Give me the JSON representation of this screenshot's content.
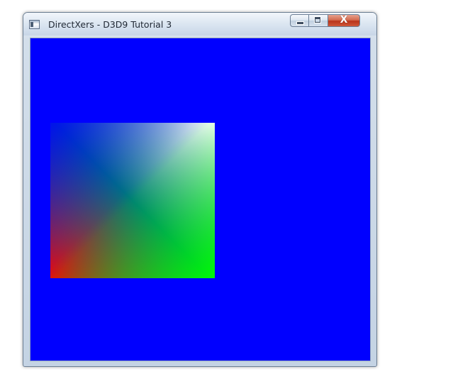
{
  "window": {
    "title": "DirectXers - D3D9 Tutorial 3",
    "close_glyph": "X",
    "icons": {
      "app": "app-window-icon",
      "minimize": "minimize-icon",
      "maximize": "maximize-icon",
      "close": "close-icon"
    }
  },
  "render": {
    "background_color": "#0000ff",
    "quad_corner_colors": {
      "top_left": "#0000ff",
      "top_right": "#ffffff",
      "bottom_left": "#ff0000",
      "bottom_right": "#00ff00"
    }
  }
}
